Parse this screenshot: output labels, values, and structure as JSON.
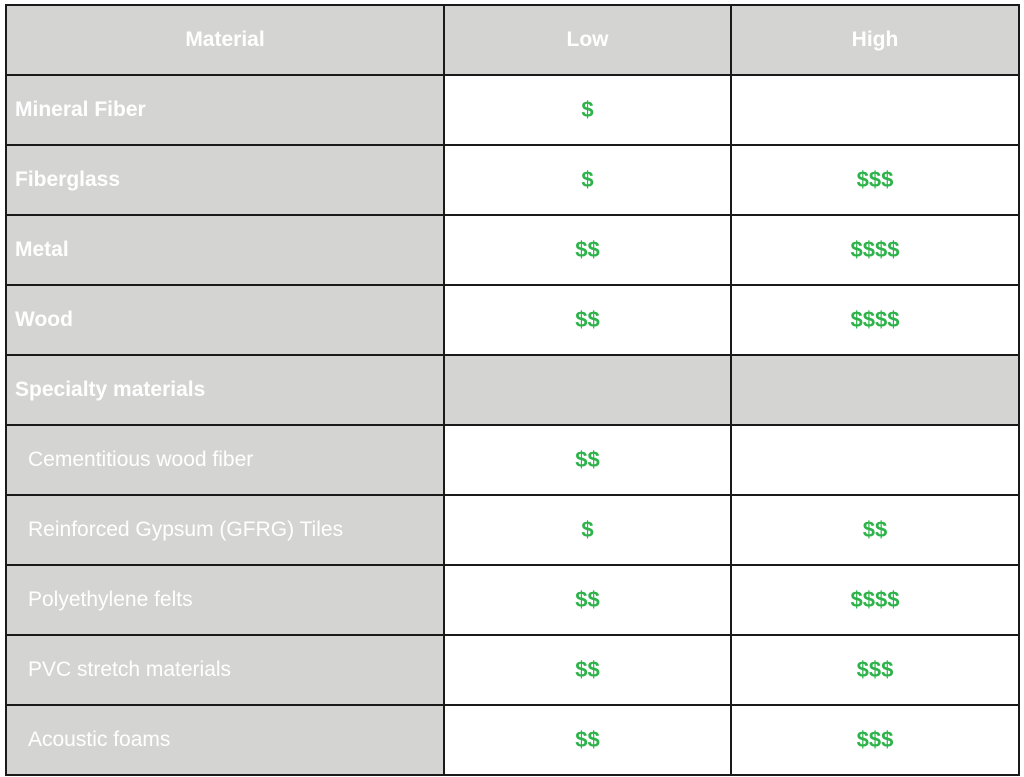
{
  "table": {
    "headers": [
      "Material",
      "Low",
      "High"
    ],
    "rows": [
      {
        "material": "Mineral Fiber",
        "low": "$",
        "high": "",
        "type": "main"
      },
      {
        "material": "Fiberglass",
        "low": "$",
        "high": "$$$",
        "type": "main"
      },
      {
        "material": "Metal",
        "low": "$$",
        "high": "$$$$",
        "type": "main"
      },
      {
        "material": "Wood",
        "low": "$$",
        "high": "$$$$",
        "type": "main"
      },
      {
        "material": "Specialty materials",
        "low": "",
        "high": "",
        "type": "section"
      },
      {
        "material": "Cementitious wood fiber",
        "low": "$$",
        "high": "",
        "type": "sub"
      },
      {
        "material": "Reinforced Gypsum (GFRG) Tiles",
        "low": "$",
        "high": "$$",
        "type": "sub"
      },
      {
        "material": "Polyethylene felts",
        "low": "$$",
        "high": "$$$$",
        "type": "sub"
      },
      {
        "material": "PVC stretch materials",
        "low": "$$",
        "high": "$$$",
        "type": "sub"
      },
      {
        "material": "Acoustic foams",
        "low": "$$",
        "high": "$$$",
        "type": "sub"
      }
    ]
  },
  "colors": {
    "header_bg": "#d4d4d3",
    "price_green": "#2db34a",
    "border": "#1a1a1a"
  }
}
